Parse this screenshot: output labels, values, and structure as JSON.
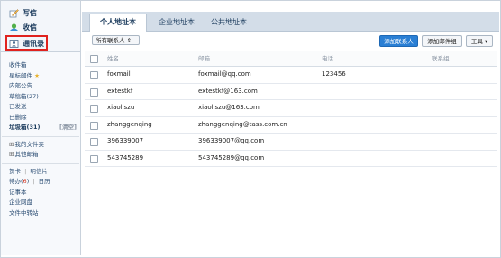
{
  "sidebar": {
    "nav": {
      "write": "写信",
      "receive": "收信",
      "contacts": "通讯录"
    },
    "folders": [
      {
        "label": "收件箱"
      },
      {
        "label": "星标邮件",
        "star": "★"
      },
      {
        "label": "内部公告"
      },
      {
        "label": "草稿箱(27)"
      },
      {
        "label": "已发送"
      },
      {
        "label": "已删除"
      },
      {
        "label": "垃圾箱(31)",
        "clear": "[清空]"
      }
    ],
    "groups": [
      {
        "prefix": "⊞",
        "label": "我的文件夹"
      },
      {
        "prefix": "⊞",
        "label": "其他邮箱"
      }
    ],
    "tools": {
      "cards": "贺卡",
      "postcard": "明信片",
      "todo_prefix": "待办(",
      "todo_count": "6",
      "todo_suffix": ")",
      "calendar": "日历",
      "notepad": "记事本",
      "netdisk": "企业网盘",
      "transfer": "文件中转站"
    },
    "divider": "|"
  },
  "tabs": [
    {
      "label": "个人地址本",
      "active": true
    },
    {
      "label": "企业地址本"
    },
    {
      "label": "公共地址本"
    }
  ],
  "toolbar": {
    "filter_value": "所有联系人",
    "filter_caret": "⇕",
    "add_contact": "添加联系人",
    "add_group": "添加邮件组",
    "tools": "工具",
    "tools_caret": "▾"
  },
  "table": {
    "headers": {
      "name": "姓名",
      "email": "邮箱",
      "phone": "电话",
      "group": "联系组"
    },
    "rows": [
      {
        "name": "foxmail",
        "email": "foxmail@qq.com",
        "phone": "123456",
        "group": ""
      },
      {
        "name": "extestkf",
        "email": "extestkf@163.com",
        "phone": "",
        "group": ""
      },
      {
        "name": "xiaoliszu",
        "email": "xiaoliszu@163.com",
        "phone": "",
        "group": ""
      },
      {
        "name": "zhanggenqing",
        "email": "zhanggenqing@tass.com.cn",
        "phone": "",
        "group": ""
      },
      {
        "name": "396339007",
        "email": "396339007@qq.com",
        "phone": "",
        "group": ""
      },
      {
        "name": "543745289",
        "email": "543745289@qq.com",
        "phone": "",
        "group": ""
      }
    ]
  },
  "colors": {
    "accent": "#2a7fd4",
    "highlight": "#e0221e",
    "tab_bar": "#d3dde8"
  }
}
